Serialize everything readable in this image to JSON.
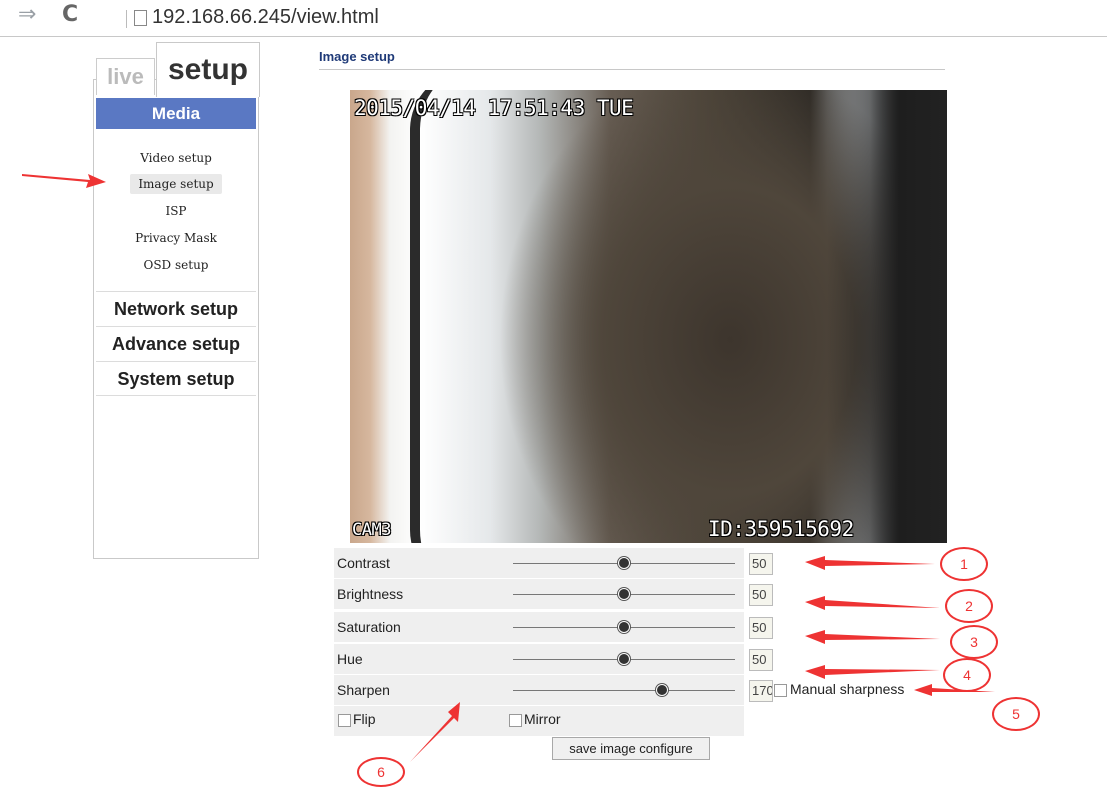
{
  "browser": {
    "url": "192.168.66.245/view.html",
    "back_icon": "arrow-right-icon",
    "reload_icon": "reload-icon"
  },
  "sidebar": {
    "tab_live": "live",
    "tab_setup": "setup",
    "media_head": "Media",
    "media_items": [
      "Video setup",
      "Image setup",
      "ISP",
      "Privacy Mask",
      "OSD setup"
    ],
    "active_item": "Image setup",
    "sections": [
      "Network setup",
      "Advance setup",
      "System setup"
    ]
  },
  "main": {
    "title": "Image setup",
    "video": {
      "osd_datetime": "2015/04/14 17:51:43 TUE",
      "osd_camera": "CAM3",
      "osd_id": "ID:359515692"
    },
    "settings": [
      {
        "label": "Contrast",
        "value": "50",
        "fraction": 0.5
      },
      {
        "label": "Brightness",
        "value": "50",
        "fraction": 0.5
      },
      {
        "label": "Saturation",
        "value": "50",
        "fraction": 0.5
      },
      {
        "label": "Hue",
        "value": "50",
        "fraction": 0.5
      },
      {
        "label": "Sharpen",
        "value": "170",
        "fraction": 0.67
      }
    ],
    "manual_sharpness_label": "Manual sharpness",
    "flip_label": "Flip",
    "mirror_label": "Mirror",
    "save_label": "save image configure"
  },
  "annotations": [
    "1",
    "2",
    "3",
    "4",
    "5",
    "6"
  ],
  "colors": {
    "annotation": "#e33333",
    "media_head": "#5a78c3",
    "title": "#1f3a78"
  }
}
